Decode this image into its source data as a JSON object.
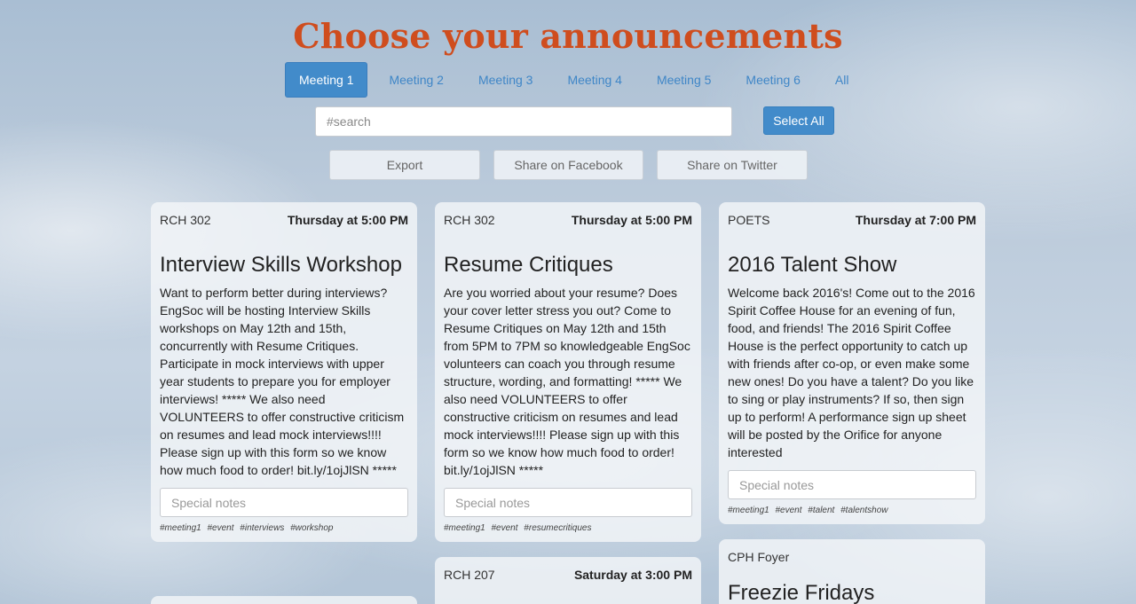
{
  "header": {
    "title": "Choose your announcements"
  },
  "tabs": [
    {
      "label": "Meeting 1",
      "active": true
    },
    {
      "label": "Meeting 2",
      "active": false
    },
    {
      "label": "Meeting 3",
      "active": false
    },
    {
      "label": "Meeting 4",
      "active": false
    },
    {
      "label": "Meeting 5",
      "active": false
    },
    {
      "label": "Meeting 6",
      "active": false
    },
    {
      "label": "All",
      "active": false
    }
  ],
  "search": {
    "placeholder": "#search",
    "value": ""
  },
  "select_all": {
    "label": "Select All"
  },
  "actions": {
    "export": "Export",
    "facebook": "Share on Facebook",
    "twitter": "Share on Twitter"
  },
  "cards": [
    {
      "location": "RCH 302",
      "time": "Thursday at 5:00 PM",
      "title": "Interview Skills Workshop",
      "body": "Want to perform better during interviews? EngSoc will be hosting Interview Skills workshops on May 12th and 15th, concurrently with Resume Critiques. Participate in mock interviews with upper year students to prepare you for employer interviews! ***** We also need VOLUNTEERS to offer constructive criticism on resumes and lead mock interviews!!!! Please sign up with this form so we know how much food to order! bit.ly/1ojJlSN *****",
      "notes_placeholder": "Special notes",
      "tags": [
        "#meeting1",
        "#event",
        "#interviews",
        "#workshop"
      ]
    },
    {
      "location": "RCH 302",
      "time": "Thursday at 5:00 PM",
      "title": "Resume Critiques",
      "body": "Are you worried about your resume? Does your cover letter stress you out? Come to Resume Critiques on May 12th and 15th from 5PM to 7PM so knowledgeable EngSoc volunteers can coach you through resume structure, wording, and formatting! ***** We also need VOLUNTEERS to offer constructive criticism on resumes and lead mock interviews!!!! Please sign up with this form so we know how much food to order! bit.ly/1ojJlSN *****",
      "notes_placeholder": "Special notes",
      "tags": [
        "#meeting1",
        "#event",
        "#resumecritiques"
      ]
    },
    {
      "location": "POETS",
      "time": "Thursday at 7:00 PM",
      "title": "2016 Talent Show",
      "body": "Welcome back 2016's! Come out to the 2016 Spirit Coffee House for an evening of fun, food, and friends! The 2016 Spirit Coffee House is the perfect opportunity to catch up with friends after co-op, or even make some new ones! Do you have a talent? Do you like to sing or play instruments? If so, then sign up to perform! A performance sign up sheet will be posted by the Orifice for anyone interested",
      "notes_placeholder": "Special notes",
      "tags": [
        "#meeting1",
        "#event",
        "#talent",
        "#talentshow"
      ]
    },
    {
      "location": "RCH 207",
      "time": "Saturday at 3:00 PM"
    },
    {
      "location": "CPH Foyer",
      "title": "Freezie Fridays"
    }
  ]
}
